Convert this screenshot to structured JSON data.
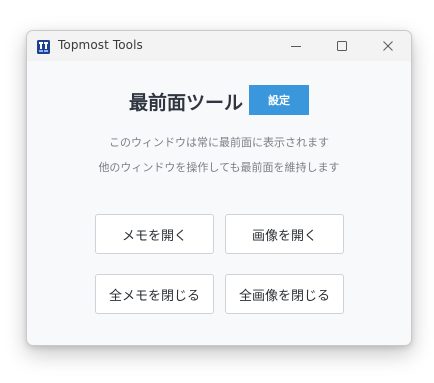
{
  "window": {
    "title": "Topmost Tools",
    "icon": "app-logo-icon"
  },
  "titlebar_controls": {
    "minimize_icon": "minimize-icon",
    "maximize_icon": "maximize-icon",
    "close_icon": "close-icon"
  },
  "main": {
    "heading": "最前面ツール",
    "settings_label": "設定",
    "description_line1": "このウィンドウは常に最前面に表示されます",
    "description_line2": "他のウィンドウを操作しても最前面を維持します"
  },
  "actions": {
    "open_memo": "メモを開く",
    "open_image": "画像を開く",
    "close_all_memos": "全メモを閉じる",
    "close_all_images": "全画像を閉じる"
  },
  "colors": {
    "accent": "#3a97dc",
    "window_bg": "#f8f9fa",
    "heading": "#2f3640",
    "description": "#7b7f85"
  }
}
